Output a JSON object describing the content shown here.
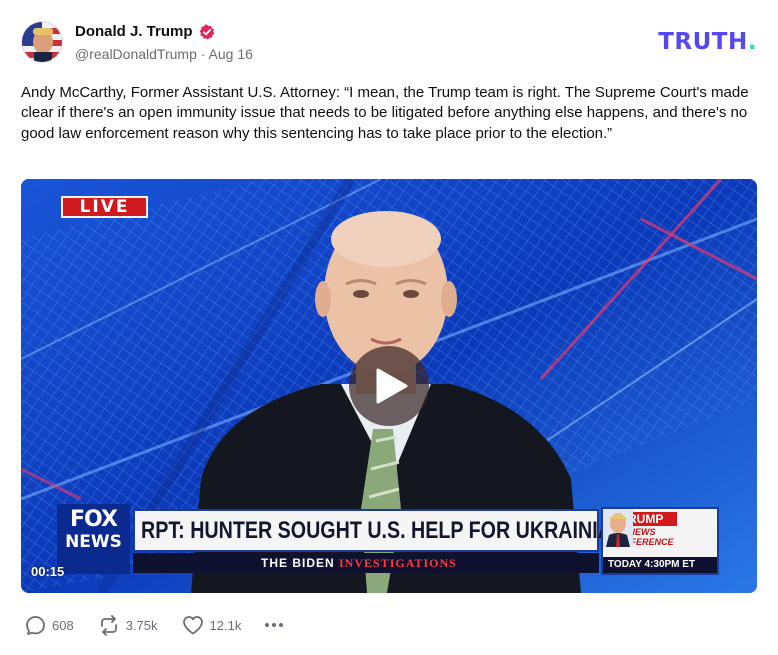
{
  "author": {
    "display_name": "Donald J. Trump",
    "handle": "@realDonaldTrump",
    "separator": "·",
    "date": "Aug 16",
    "verified_icon": "verified-badge-icon",
    "verified_color": "#e2245b"
  },
  "brand": {
    "text": "TRUTH",
    "dot": ".",
    "color": "#5448ee",
    "dot_color": "#27e1c1"
  },
  "post": {
    "text": "Andy McCarthy, Former Assistant U.S. Attorney: “I mean, the Trump team is right. The Supreme Court's made clear if there's an open immunity issue that needs to be litigated before anything else happens, and there's no good law enforcement reason why this sentencing has to take place prior to the election.”"
  },
  "video": {
    "live_label": "LIVE",
    "chyron": "RPT: HUNTER SOUGHT U.S. HELP FOR UKRAINIAN BIZ",
    "subbar_left": "THE BIDEN",
    "subbar_right": "INVESTIGATIONS",
    "network_top": "FOX",
    "network_bottom": "NEWS",
    "promo_title": "TRUMP",
    "promo_sub": "NEWS CONFERENCE",
    "promo_time": "TODAY 4:30PM ET",
    "timestamp": "00:15",
    "play_icon": "play-icon"
  },
  "actions": {
    "replies": "608",
    "reposts": "3.75k",
    "likes": "12.1k",
    "reply_icon": "reply-bubble-icon",
    "repost_icon": "repost-icon",
    "like_icon": "heart-icon",
    "more_icon": "more-dots-icon"
  }
}
